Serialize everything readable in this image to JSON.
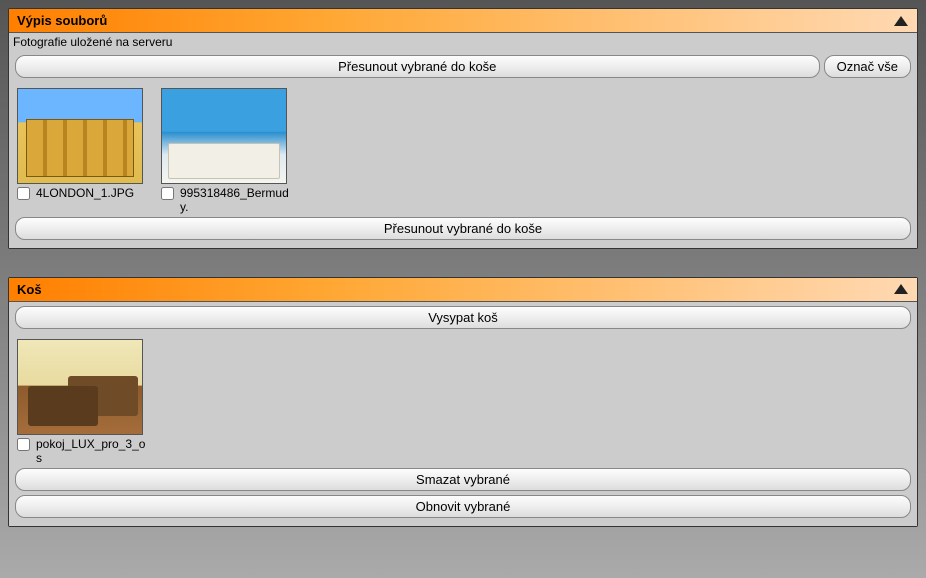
{
  "filesPanel": {
    "title": "Výpis souborů",
    "subtitle": "Fotografie uložené na serveru",
    "moveToTrash": "Přesunout vybrané do koše",
    "selectAll": "Označ vše",
    "items": [
      {
        "name": "4LONDON_1.JPG"
      },
      {
        "name": "995318486_Bermudy."
      }
    ]
  },
  "trashPanel": {
    "title": "Koš",
    "emptyTrash": "Vysypat koš",
    "deleteSelected": "Smazat vybrané",
    "restoreSelected": "Obnovit vybrané",
    "items": [
      {
        "name": "pokoj_LUX_pro_3_os"
      }
    ]
  }
}
